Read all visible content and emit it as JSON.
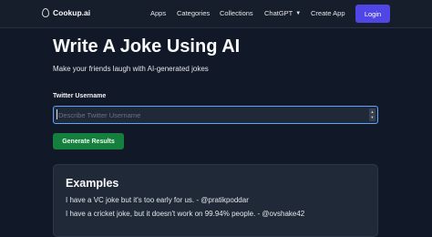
{
  "nav": {
    "brand": "Cookup.ai",
    "links": [
      "Apps",
      "Categories",
      "Collections",
      "ChatGPT",
      "Create App"
    ],
    "login_label": "Login",
    "accent_color": "#4f46e5"
  },
  "hero": {
    "title": "Write A Joke Using AI",
    "subtitle": "Make your friends laugh with AI-generated jokes"
  },
  "form": {
    "label": "Twitter Username",
    "input_value": "",
    "input_placeholder": "Describe Twitter Username",
    "submit_label": "Generate Results",
    "submit_color": "#15803d"
  },
  "examples": {
    "title": "Examples",
    "items": [
      "I have a VC joke but it's too early for us. - @pratikpoddar",
      "I have a cricket joke, but it doesn't work on 99.94% people. - @ovshake42"
    ]
  }
}
